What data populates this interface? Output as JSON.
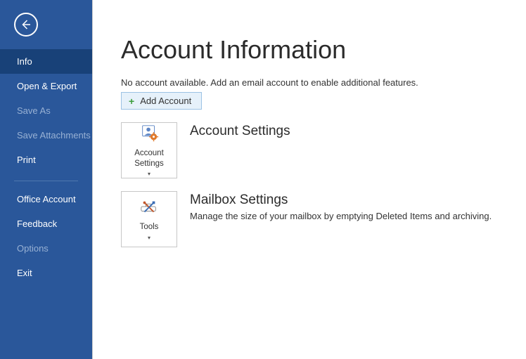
{
  "sidebar": {
    "items": [
      {
        "label": "Info",
        "selected": true,
        "disabled": false
      },
      {
        "label": "Open & Export",
        "selected": false,
        "disabled": false
      },
      {
        "label": "Save As",
        "selected": false,
        "disabled": true
      },
      {
        "label": "Save Attachments",
        "selected": false,
        "disabled": true
      },
      {
        "label": "Print",
        "selected": false,
        "disabled": false
      }
    ],
    "items2": [
      {
        "label": "Office Account",
        "selected": false,
        "disabled": false
      },
      {
        "label": "Feedback",
        "selected": false,
        "disabled": false
      },
      {
        "label": "Options",
        "selected": false,
        "disabled": true
      },
      {
        "label": "Exit",
        "selected": false,
        "disabled": false
      }
    ]
  },
  "main": {
    "title": "Account Information",
    "subtitle": "No account available. Add an email account to enable additional features.",
    "add_account_label": "Add Account",
    "sections": {
      "account_settings": {
        "tile_label": "Account Settings",
        "title": "Account Settings"
      },
      "mailbox_settings": {
        "tile_label": "Tools",
        "title": "Mailbox Settings",
        "desc": "Manage the size of your mailbox by emptying Deleted Items and archiving."
      }
    }
  }
}
